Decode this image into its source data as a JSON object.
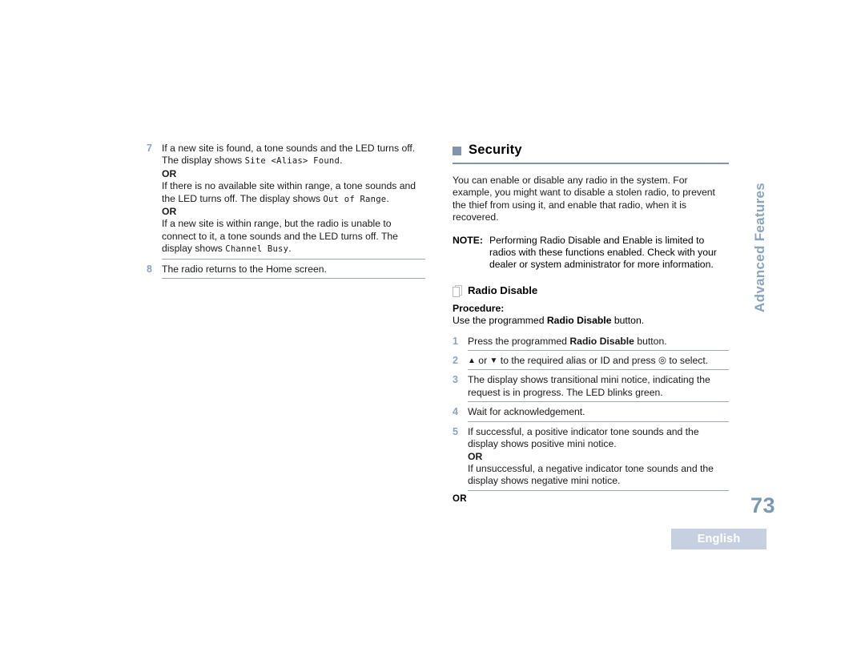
{
  "document": {
    "page_number": "73",
    "language_badge": "English",
    "side_tab": "Advanced Features"
  },
  "left_column": {
    "steps": [
      {
        "number": "7",
        "lines": [
          {
            "type": "text",
            "text": "If a new site is found, a tone sounds and the LED turns off."
          },
          {
            "type": "mixed",
            "pre": "The display shows ",
            "mono": "Site <Alias> Found",
            "post": "."
          },
          {
            "type": "or",
            "text": "OR"
          },
          {
            "type": "text",
            "text": "If there is no available site within range, a tone sounds and"
          },
          {
            "type": "mixed",
            "pre": "the LED turns off. The display shows ",
            "mono": "Out of Range",
            "post": "."
          },
          {
            "type": "or",
            "text": "OR"
          },
          {
            "type": "text",
            "text": "If a new site is within range, but the radio is unable to"
          },
          {
            "type": "text",
            "text": "connect to it, a tone sounds and the LED turns off. The"
          },
          {
            "type": "mixed",
            "pre": "display shows ",
            "mono": "Channel Busy",
            "post": "."
          }
        ]
      },
      {
        "number": "8",
        "lines": [
          {
            "type": "text",
            "text": "The radio returns to the Home screen."
          }
        ]
      }
    ]
  },
  "right_column": {
    "section": {
      "title": "Security",
      "intro": "You can enable or disable any radio in the system. For example, you might want to disable a stolen radio, to prevent the thief from using it, and enable that radio, when it is recovered."
    },
    "note": {
      "label": "NOTE:",
      "text": "Performing Radio Disable and Enable is limited to radios with these functions enabled. Check with your dealer or system administrator for more information."
    },
    "subsection": {
      "title": "Radio Disable",
      "procedure_label": "Procedure:",
      "procedure_pre": "Use the programmed ",
      "procedure_bold": "Radio Disable",
      "procedure_post": " button."
    },
    "steps": [
      {
        "number": "1",
        "pre": "Press the programmed ",
        "bold": "Radio Disable",
        "post": " button."
      },
      {
        "number": "2",
        "up_glyph": "▲",
        "or_word": " or ",
        "down_glyph": "▼",
        "mid": " to the required alias or ID and press ",
        "select_glyph": "◎",
        "post": " to select."
      },
      {
        "number": "3",
        "line1": "The display shows transitional mini notice, indicating the",
        "line2": "request is in progress. The LED blinks green."
      },
      {
        "number": "4",
        "line1": "Wait for acknowledgement."
      },
      {
        "number": "5",
        "line1": "If successful, a positive indicator tone sounds and the",
        "line2": "display shows positive mini notice.",
        "or_text": "OR",
        "line3": "If unsuccessful, a negative indicator tone sounds and the",
        "line4": "display shows negative mini notice."
      }
    ],
    "trailing_or": "OR"
  },
  "colors": {
    "accent_blue": "#8096b0",
    "step_number": "#8aa4c0",
    "page_number": "#7b97b6",
    "badge_bg": "#c6d0e0",
    "rule": "#9aa9bd"
  }
}
